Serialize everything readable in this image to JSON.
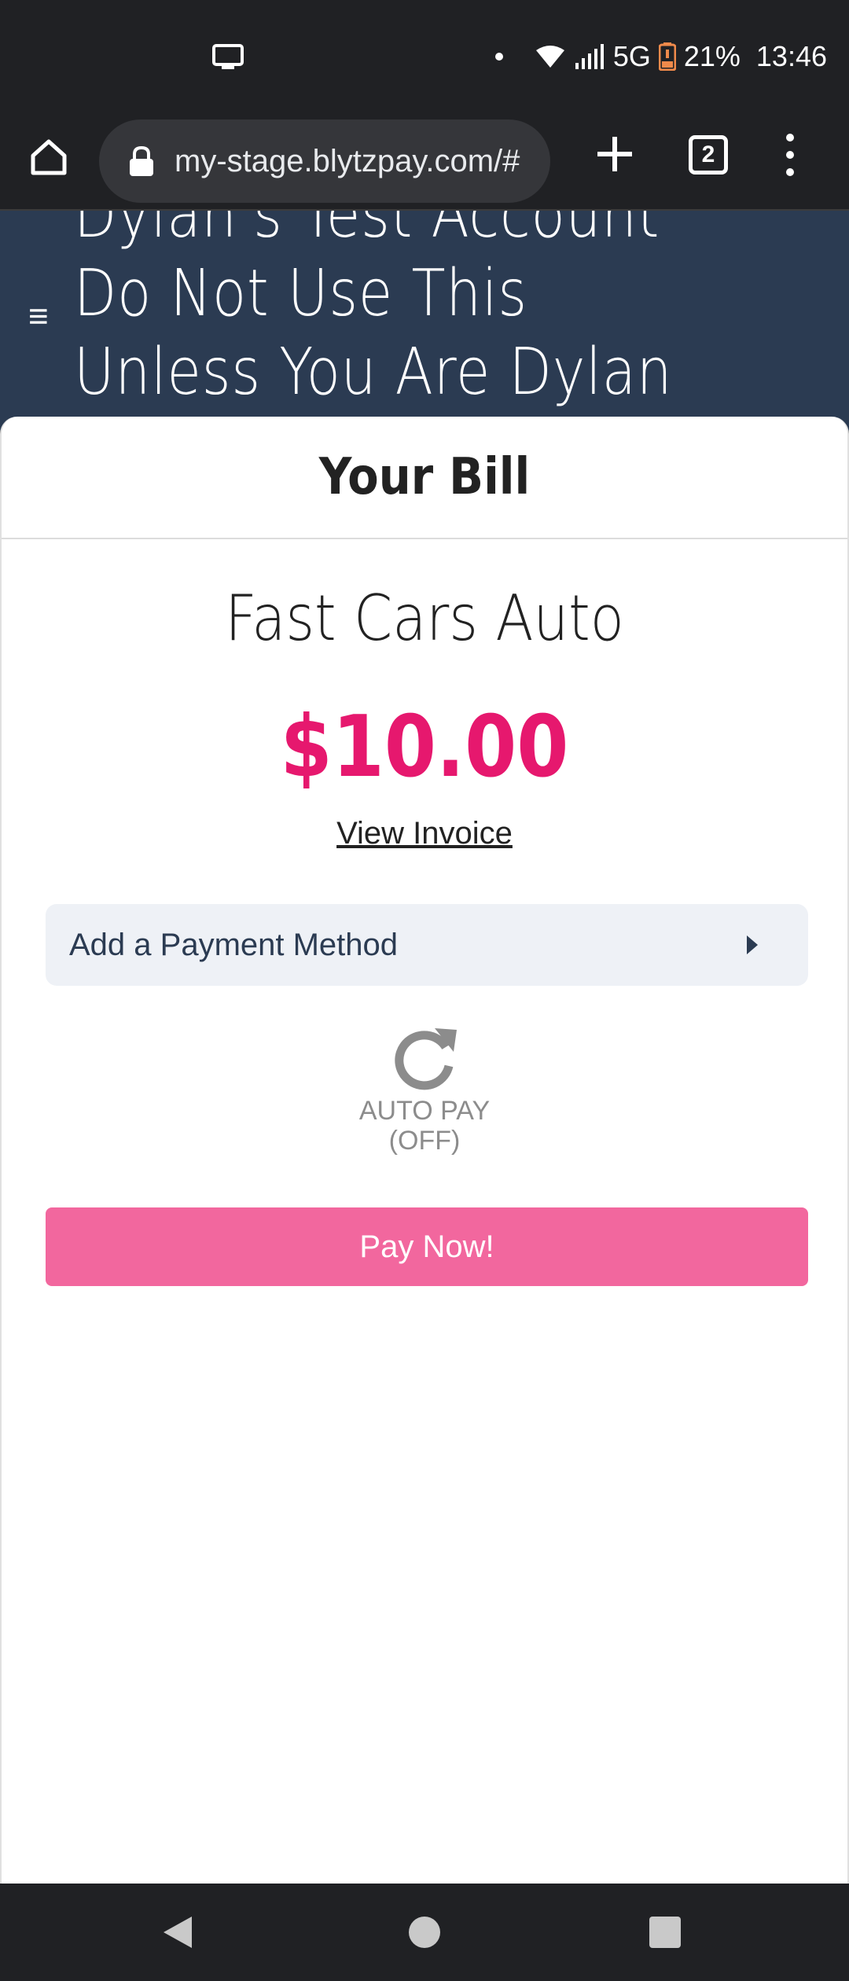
{
  "status_bar": {
    "network": "5G",
    "battery": "21%",
    "time": "13:46",
    "icons": [
      "cast-icon",
      "wifi-icon",
      "signal-icon",
      "battery-icon"
    ]
  },
  "browser": {
    "url": "my-stage.blytzpay.com/#",
    "tab_count": "2",
    "icons": [
      "home-icon",
      "lock-icon",
      "plus-icon",
      "tabs-icon",
      "more-vert-icon"
    ]
  },
  "header": {
    "menu_icon": "≡",
    "title": "Dylan's Test Account Do Not Use This Unless You Are Dylan"
  },
  "bill": {
    "title": "Your Bill",
    "merchant": "Fast Cars Auto",
    "amount": "$10.00",
    "view_invoice": "View Invoice",
    "payment_method_label": "Add a Payment Method",
    "autopay_label": "AUTO PAY",
    "autopay_state": "(OFF)",
    "pay_now_label": "Pay Now!"
  },
  "colors": {
    "header_bg": "#2b3b52",
    "amount": "#e6186e",
    "pay_button": "#f2679e",
    "payment_bg": "#eef1f6"
  }
}
